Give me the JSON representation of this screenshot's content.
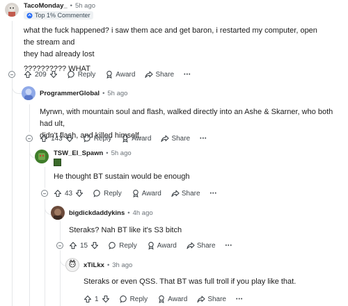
{
  "comments": [
    {
      "username": "TacoMonday_",
      "time": "5h ago",
      "badge": "Top 1% Commenter",
      "lines": [
        "what the fuck happened? i saw them ace and get baron, i restarted my computer, open the stream and",
        "they had already lost",
        "",
        "?????????? WHAT"
      ],
      "votes": "209"
    },
    {
      "username": "ProgrammerGlobal",
      "time": "5h ago",
      "lines": [
        "Myrwn, with mountain soul and flash, walked directly into an Ashe & Skarner, who both had ult,",
        "didn't flash, and killed himself."
      ],
      "votes": "143"
    },
    {
      "username": "TSW_El_Spawn",
      "time": "5h ago",
      "lines": [
        "He thought BT sustain would be enough"
      ],
      "votes": "43"
    },
    {
      "username": "bigdickdaddykins",
      "time": "4h ago",
      "lines": [
        "Steraks? Nah BT like it's S3 bitch"
      ],
      "votes": "15"
    },
    {
      "username": "xTiLkx",
      "time": "3h ago",
      "lines": [
        "Steraks or even QSS. That BT was full troll if you play like that."
      ],
      "votes": "1"
    }
  ],
  "actions": {
    "reply": "Reply",
    "award": "Award",
    "share": "Share",
    "more": "•••"
  },
  "separator": "•",
  "icons": {
    "upvote": "upvote-arrow-icon",
    "downvote": "downvote-arrow-icon",
    "reply": "speech-bubble-icon",
    "award": "award-medal-icon",
    "share": "share-arrow-icon",
    "collapse": "collapse-minus-icon"
  }
}
